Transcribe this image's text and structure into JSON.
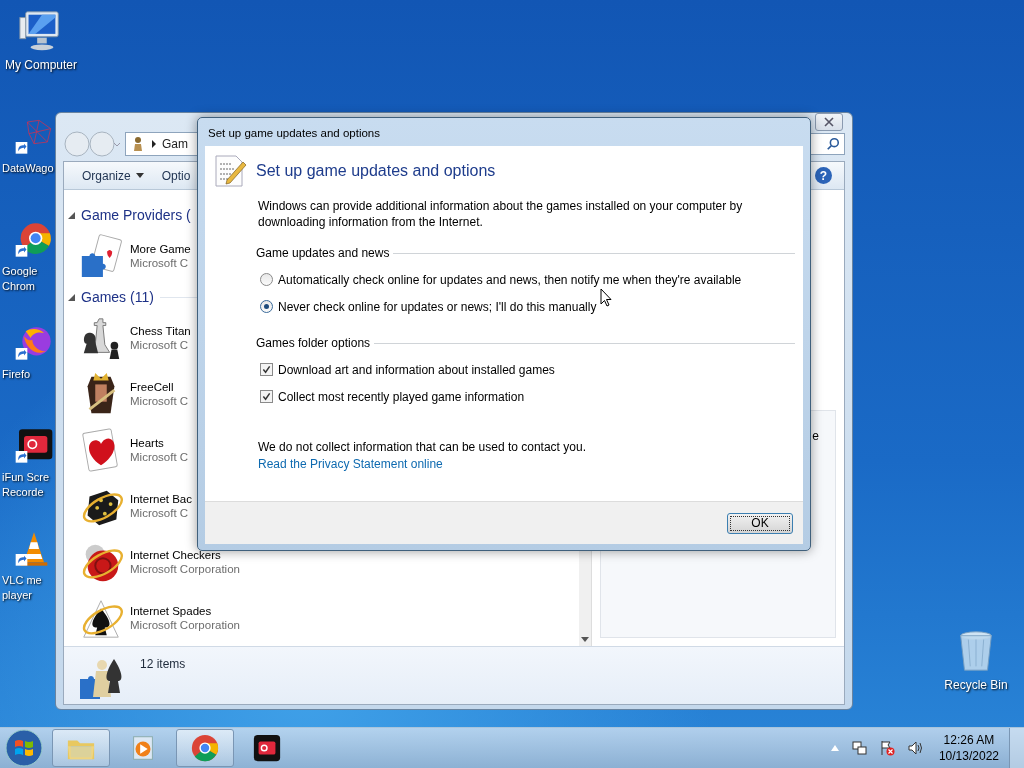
{
  "desktop_icons": [
    {
      "lines": [
        "My Computer"
      ]
    },
    {
      "lines": [
        "DataWago"
      ]
    },
    {
      "lines": [
        "Google",
        "Chrom"
      ]
    },
    {
      "lines": [
        "Firefo"
      ]
    },
    {
      "lines": [
        "iFun Scre",
        "Recorde"
      ]
    },
    {
      "lines": [
        "VLC me",
        "player"
      ]
    }
  ],
  "recycle_bin": {
    "label": "Recycle Bin"
  },
  "explorer": {
    "breadcrumb": "Gam",
    "toolbar": [
      {
        "label": "Organize",
        "menu": true
      },
      {
        "label": "Optio",
        "menu": false
      }
    ],
    "groups": [
      {
        "title": "Game Providers (",
        "expanded": true,
        "items": [
          {
            "name": "More Game",
            "publisher": "Microsoft C"
          }
        ]
      },
      {
        "title": "Games (11)",
        "expanded": true,
        "items": [
          {
            "name": "Chess Titan",
            "publisher": "Microsoft C"
          },
          {
            "name": "FreeCell",
            "publisher": "Microsoft C"
          },
          {
            "name": "Hearts",
            "publisher": "Microsoft C"
          },
          {
            "name": "Internet Bac",
            "publisher": "Microsoft C"
          },
          {
            "name": "Internet Checkers",
            "publisher": "Microsoft Corporation"
          },
          {
            "name": "Internet Spades",
            "publisher": "Microsoft Corporation"
          }
        ]
      }
    ],
    "preview_text": "e",
    "status": "12 items",
    "help_label": "?"
  },
  "dialog": {
    "title": "Set up game updates and options",
    "heading": "Set up game updates and options",
    "intro": "Windows can provide additional information about the games installed on your computer by downloading information from the Internet.",
    "sections": [
      {
        "title": "Game updates and news",
        "options": [
          {
            "kind": "radio",
            "label": "Automatically check online for updates and news, then notify me when they're available",
            "selected": false
          },
          {
            "kind": "radio",
            "label": "Never check online for updates or news; I'll do this manually",
            "selected": true
          }
        ]
      },
      {
        "title": "Games folder options",
        "options": [
          {
            "kind": "checkbox",
            "label": "Download art and information about installed games",
            "checked": true
          },
          {
            "kind": "checkbox",
            "label": "Collect most recently played game information",
            "checked": true
          }
        ]
      }
    ],
    "privacy_note": "We do not collect information that can be used to contact you.",
    "privacy_link": "Read the Privacy Statement online",
    "buttons": [
      "OK"
    ]
  },
  "taskbar": {
    "apps": [
      {
        "running": true
      },
      {
        "running": false
      },
      {
        "running": true
      },
      {
        "running": false
      }
    ],
    "clock": {
      "time": "12:26 AM",
      "date": "10/13/2022"
    }
  }
}
